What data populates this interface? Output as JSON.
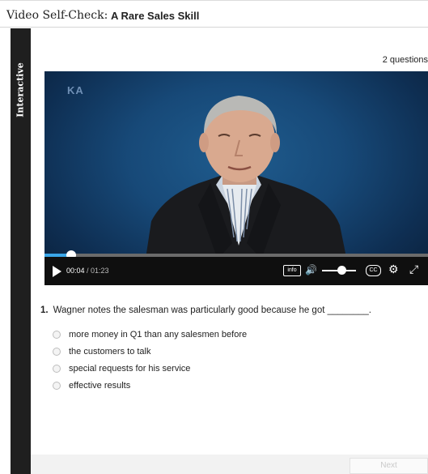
{
  "header": {
    "prefix": "Video Self-Check:",
    "title": "A Rare Sales Skill"
  },
  "sidebar": {
    "label": "Interactive"
  },
  "meta": {
    "question_count": "2 questions"
  },
  "video": {
    "logo": "KA",
    "current_time": "00:04",
    "total_time": " / 01:23",
    "info_label": "info",
    "cc_label": "CC",
    "progress_fraction": 0.07,
    "volume_fraction": 0.55,
    "accent_color": "#3aa6e8"
  },
  "question": {
    "number": "1.",
    "text": "Wagner notes the salesman was particularly good because he got ________.",
    "options": [
      "more money in Q1 than any salesmen before",
      "the customers to talk",
      "special requests for his service",
      "effective results"
    ]
  },
  "footer": {
    "next_label": "Next"
  },
  "icons": {
    "play": "play-icon",
    "volume": "volume-icon",
    "settings": "gear-icon",
    "fullscreen": "fullscreen-icon"
  }
}
